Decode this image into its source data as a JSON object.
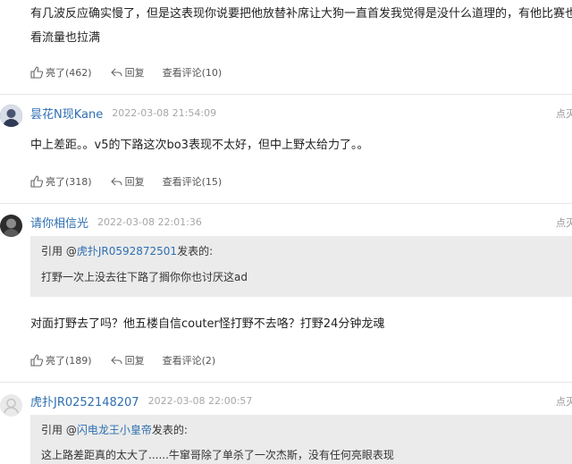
{
  "comment0": {
    "line1": "有几波反应确实慢了，但是这表现你说要把他放替补席让大狗一直首发我觉得是没什么道理的，有他比赛也好",
    "line2": "看流量也拉满",
    "likes": "亮了(462)",
    "reply": "回复",
    "view": "查看评论(10)"
  },
  "comment1": {
    "user": "昙花N现Kane",
    "time": "2022-03-08 21:54:09",
    "more": "点灭",
    "text": "中上差距。。v5的下路这次bo3表现不太好，但中上野太给力了。。",
    "likes": "亮了(318)",
    "reply": "回复",
    "view": "查看评论(15)"
  },
  "comment2": {
    "user": "请你相信光",
    "time": "2022-03-08 22:01:36",
    "more": "点灭",
    "quote_prefix": "引用 @",
    "quote_user": "虎扑JR0592872501",
    "quote_suffix": "发表的:",
    "quote_text": "打野一次上没去往下路了搁你你也讨厌这ad",
    "text": "对面打野去了吗？他五楼自信couter怪打野不去咯？打野24分钟龙魂",
    "likes": "亮了(189)",
    "reply": "回复",
    "view": "查看评论(2)"
  },
  "comment3": {
    "user": "虎扑JR0252148207",
    "time": "2022-03-08 22:00:57",
    "more": "点灭",
    "quote_prefix": "引用 @",
    "quote_user": "闪电龙王小皇帝",
    "quote_suffix": "发表的:",
    "quote_text": "这上路差距真的太大了......牛窜哥除了单杀了一次杰斯，没有任何亮眼表现"
  },
  "icons": {
    "like": "thumbs-up-icon",
    "reply": "reply-arrow-icon"
  },
  "colors": {
    "link": "#2e6fb1",
    "quote_bg": "#ebebeb",
    "divider": "#e6e6e6"
  }
}
